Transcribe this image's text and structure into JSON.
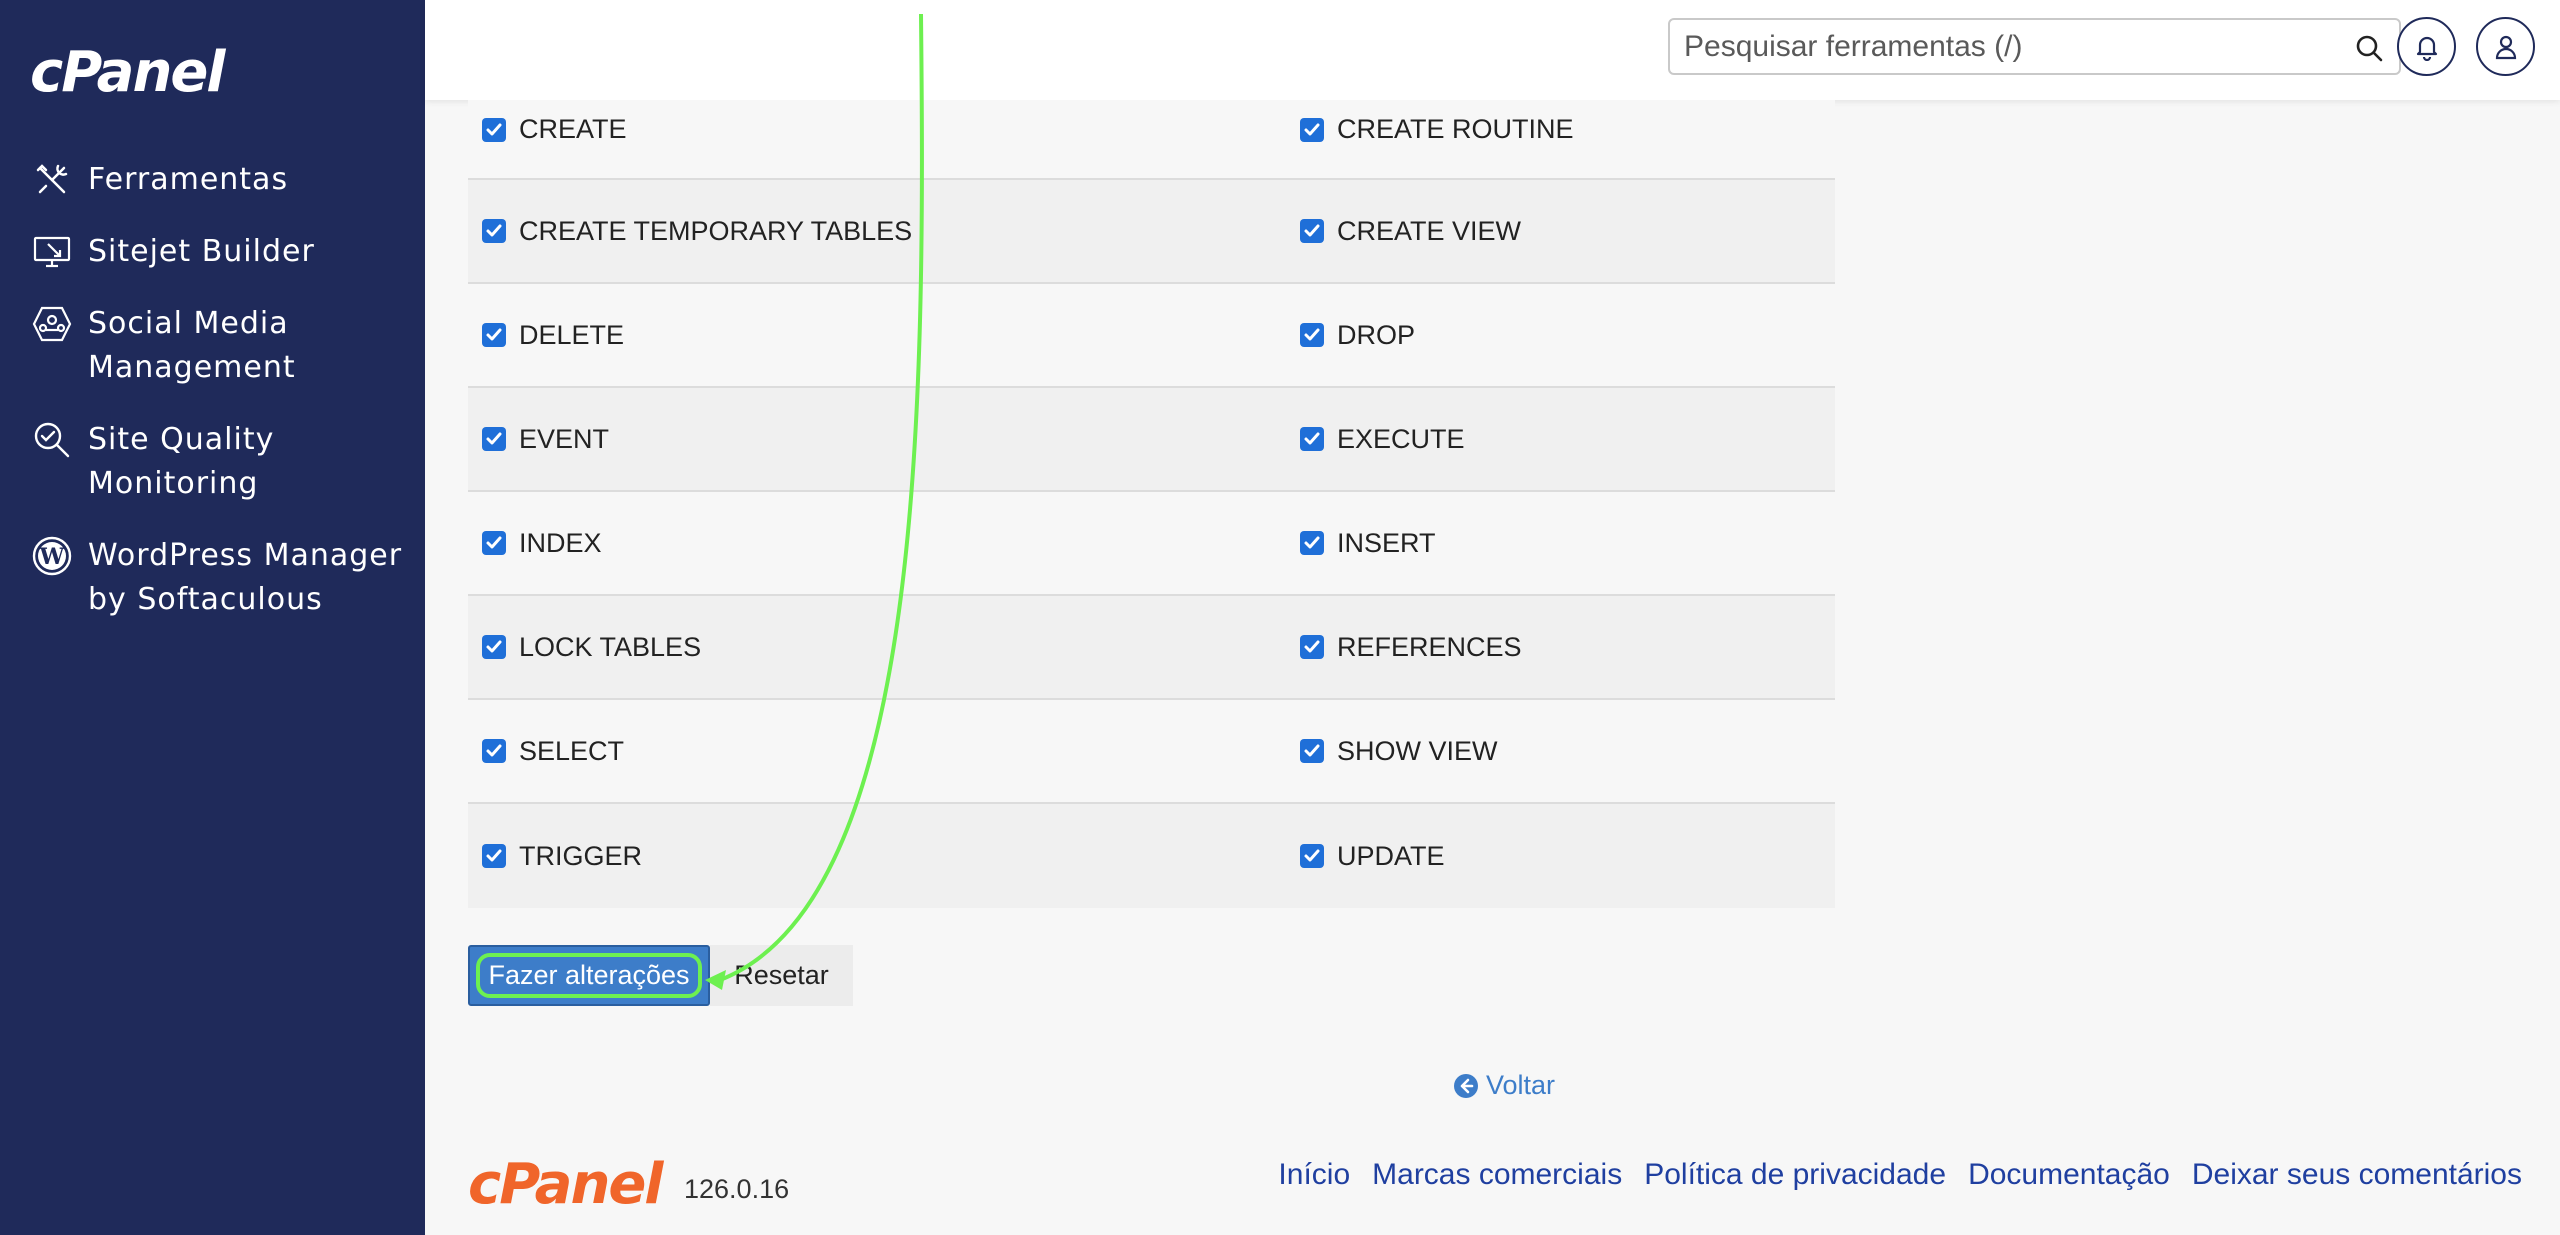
{
  "sidebar": {
    "logo": "cPanel",
    "items": [
      {
        "label": "Ferramentas",
        "icon": "tools-icon"
      },
      {
        "label": "Sitejet Builder",
        "icon": "monitor-icon"
      },
      {
        "label": "Social Media Management",
        "icon": "social-icon"
      },
      {
        "label": "Site Quality Monitoring",
        "icon": "magnifier-check-icon"
      },
      {
        "label": "WordPress Manager by Softaculous",
        "icon": "wordpress-icon"
      }
    ]
  },
  "header": {
    "search_placeholder": "Pesquisar ferramentas (/)"
  },
  "privileges": [
    [
      "CREATE",
      "CREATE ROUTINE"
    ],
    [
      "CREATE TEMPORARY TABLES",
      "CREATE VIEW"
    ],
    [
      "DELETE",
      "DROP"
    ],
    [
      "EVENT",
      "EXECUTE"
    ],
    [
      "INDEX",
      "INSERT"
    ],
    [
      "LOCK TABLES",
      "REFERENCES"
    ],
    [
      "SELECT",
      "SHOW VIEW"
    ],
    [
      "TRIGGER",
      "UPDATE"
    ]
  ],
  "actions": {
    "submit": "Fazer alterações",
    "reset": "Resetar",
    "back": "Voltar"
  },
  "footer": {
    "logo": "cPanel",
    "version": "126.0.16",
    "links": [
      "Início",
      "Marcas comerciais",
      "Política de privacidade",
      "Documentação",
      "Deixar seus comentários"
    ]
  },
  "colors": {
    "sidebar": "#1f2a5a",
    "checkbox": "#1f6fd8",
    "primary": "#3d7dc9",
    "annotation": "#6df050",
    "brand_orange": "#f0652a"
  }
}
